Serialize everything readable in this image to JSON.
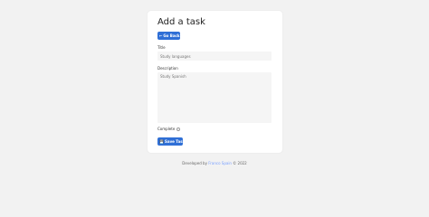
{
  "page": {
    "title": "Add a task"
  },
  "buttons": {
    "back_label": "Go Back",
    "save_label": "Save Task"
  },
  "form": {
    "title_label": "Title",
    "title_placeholder": "Study languages",
    "description_label": "Description",
    "description_placeholder": "Study Spanish",
    "complete_label": "Complete"
  },
  "footer": {
    "prefix": "Developed by",
    "author": "Franco Spain",
    "suffix": "© 2022"
  },
  "colors": {
    "accent": "#2f6fd6",
    "link": "#7aa1ff",
    "background": "#f2f2f2"
  },
  "icons": {
    "back": "arrow-left-icon",
    "save": "save-icon"
  }
}
